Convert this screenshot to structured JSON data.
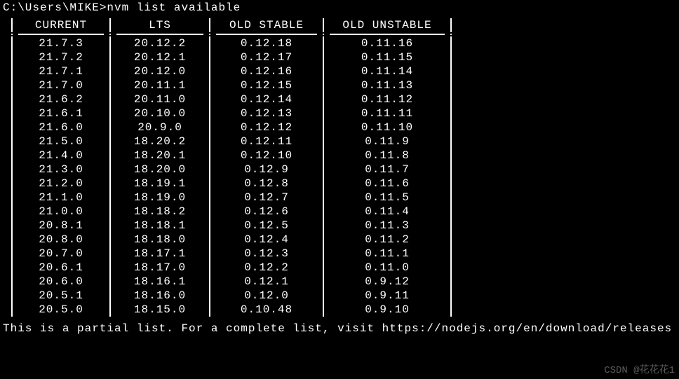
{
  "prompt": "C:\\Users\\MIKE>",
  "command": "nvm list available",
  "headers": [
    "CURRENT",
    "LTS",
    "OLD STABLE",
    "OLD UNSTABLE"
  ],
  "rows": [
    [
      "21.7.3",
      "20.12.2",
      "0.12.18",
      "0.11.16"
    ],
    [
      "21.7.2",
      "20.12.1",
      "0.12.17",
      "0.11.15"
    ],
    [
      "21.7.1",
      "20.12.0",
      "0.12.16",
      "0.11.14"
    ],
    [
      "21.7.0",
      "20.11.1",
      "0.12.15",
      "0.11.13"
    ],
    [
      "21.6.2",
      "20.11.0",
      "0.12.14",
      "0.11.12"
    ],
    [
      "21.6.1",
      "20.10.0",
      "0.12.13",
      "0.11.11"
    ],
    [
      "21.6.0",
      "20.9.0",
      "0.12.12",
      "0.11.10"
    ],
    [
      "21.5.0",
      "18.20.2",
      "0.12.11",
      "0.11.9"
    ],
    [
      "21.4.0",
      "18.20.1",
      "0.12.10",
      "0.11.8"
    ],
    [
      "21.3.0",
      "18.20.0",
      "0.12.9",
      "0.11.7"
    ],
    [
      "21.2.0",
      "18.19.1",
      "0.12.8",
      "0.11.6"
    ],
    [
      "21.1.0",
      "18.19.0",
      "0.12.7",
      "0.11.5"
    ],
    [
      "21.0.0",
      "18.18.2",
      "0.12.6",
      "0.11.4"
    ],
    [
      "20.8.1",
      "18.18.1",
      "0.12.5",
      "0.11.3"
    ],
    [
      "20.8.0",
      "18.18.0",
      "0.12.4",
      "0.11.2"
    ],
    [
      "20.7.0",
      "18.17.1",
      "0.12.3",
      "0.11.1"
    ],
    [
      "20.6.1",
      "18.17.0",
      "0.12.2",
      "0.11.0"
    ],
    [
      "20.6.0",
      "18.16.1",
      "0.12.1",
      "0.9.12"
    ],
    [
      "20.5.1",
      "18.16.0",
      "0.12.0",
      "0.9.11"
    ],
    [
      "20.5.0",
      "18.15.0",
      "0.10.48",
      "0.9.10"
    ]
  ],
  "footer": "This is a partial list. For a complete list, visit https://nodejs.org/en/download/releases",
  "watermark": "CSDN @花花花1"
}
